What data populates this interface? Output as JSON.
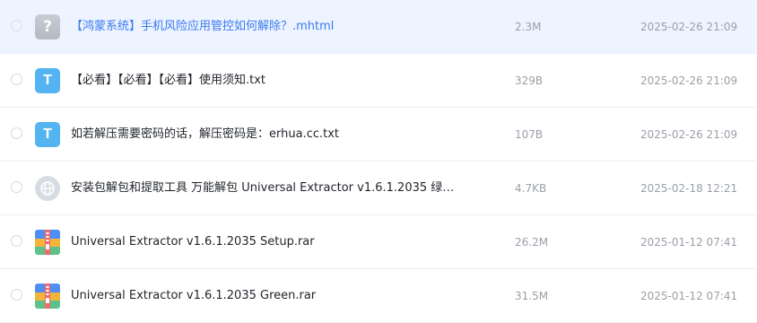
{
  "files": [
    {
      "name": "【鸿蒙系统】手机风险应用管控如何解除？.mhtml",
      "size": "2.3M",
      "date": "2025-02-26 21:09",
      "icon": "unknown-file-icon",
      "icon_glyph": "?",
      "selected": true
    },
    {
      "name": "【必看】【必看】【必看】使用须知.txt",
      "size": "329B",
      "date": "2025-02-26 21:09",
      "icon": "text-file-icon",
      "icon_glyph": "T"
    },
    {
      "name": "如若解压需要密码的话，解压密码是：erhua.cc.txt",
      "size": "107B",
      "date": "2025-02-26 21:09",
      "icon": "text-file-icon",
      "icon_glyph": "T"
    },
    {
      "name": "安装包解包和提取工具 万能解包 Universal Extractor v1.6.1.2035 绿…",
      "size": "4.7KB",
      "date": "2025-02-18 12:21",
      "icon": "web-link-icon"
    },
    {
      "name": "Universal Extractor v1.6.1.2035 Setup.rar",
      "size": "26.2M",
      "date": "2025-01-12 07:41",
      "icon": "archive-icon"
    },
    {
      "name": "Universal Extractor v1.6.1.2035 Green.rar",
      "size": "31.5M",
      "date": "2025-01-12 07:41",
      "icon": "archive-icon"
    }
  ],
  "colors": {
    "selected_row_bg": "#edf3ff",
    "selected_text": "#3a7bf0",
    "text_icon_blue": "#54b4f2",
    "meta_gray": "#9aa0a8"
  }
}
